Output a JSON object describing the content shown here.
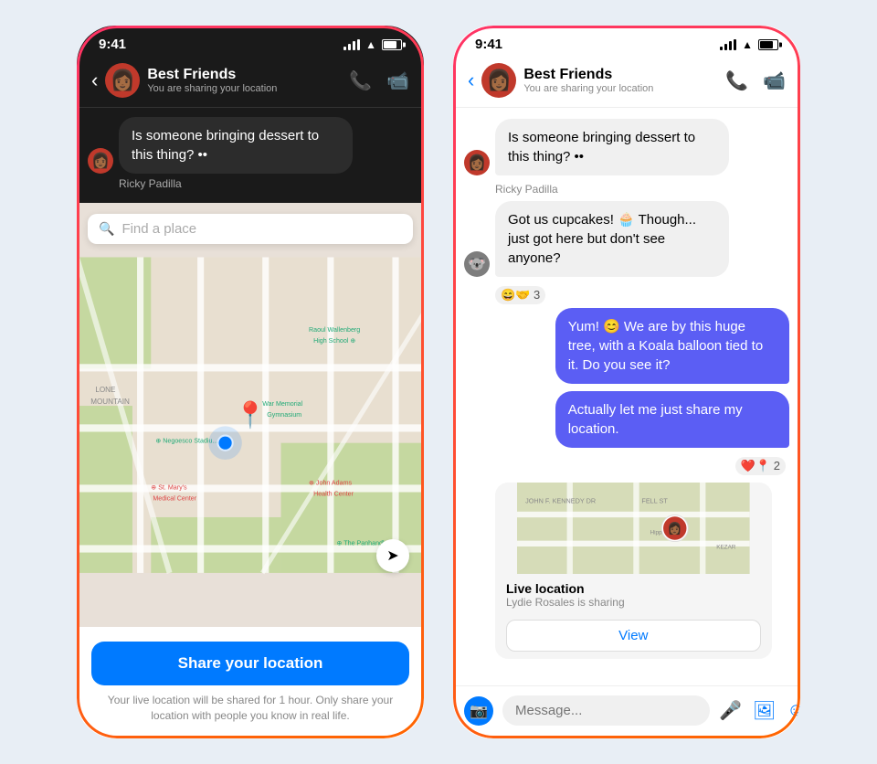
{
  "left_phone": {
    "status_bar": {
      "time": "9:41"
    },
    "header": {
      "group_name": "Best Friends",
      "subtitle": "You are sharing your location",
      "back_label": "‹",
      "call_icon": "📞",
      "video_icon": "📹"
    },
    "chat_preview": {
      "message": "Is someone bringing dessert to this thing? ••",
      "sender": "Ricky Padilla"
    },
    "map": {
      "search_placeholder": "Find a place"
    },
    "share": {
      "button_label": "Share your location",
      "disclaimer": "Your live location will be shared for 1 hour. Only share your location with people you know in real life."
    }
  },
  "right_phone": {
    "status_bar": {
      "time": "9:41"
    },
    "header": {
      "group_name": "Best Friends",
      "subtitle": "You are sharing your location",
      "back_label": "‹",
      "call_icon": "📞",
      "video_icon": "📹"
    },
    "messages": [
      {
        "id": 1,
        "type": "incoming",
        "avatar": "👩🏾",
        "avatar_bg": "#c0392b",
        "text": "Is someone bringing dessert to this thing? ••",
        "sender_name": "Ricky Padilla",
        "reactions": null
      },
      {
        "id": 2,
        "type": "incoming",
        "avatar": "🐨",
        "avatar_bg": "#7d7d7d",
        "text": "Got us cupcakes! 🧁 Though... just got here but don't see anyone?",
        "sender_name": null,
        "reactions": [
          {
            "emoji": "😄🤝",
            "count": "3"
          }
        ]
      },
      {
        "id": 3,
        "type": "outgoing",
        "text": "Yum! 😊 We are by this huge tree, with a Koala balloon tied to it. Do you see it?",
        "reactions": null
      },
      {
        "id": 4,
        "type": "outgoing",
        "text": "Actually let me just share my location.",
        "reactions": [
          {
            "emoji": "❤️📍",
            "count": "2"
          }
        ]
      }
    ],
    "location_card": {
      "title": "Live location",
      "subtitle": "Lydie Rosales is sharing",
      "view_button": "View"
    },
    "input": {
      "placeholder": "Message...",
      "camera_icon": "📷",
      "mic_icon": "🎤",
      "photo_icon": "🖼",
      "sticker_icon": "☺"
    }
  }
}
